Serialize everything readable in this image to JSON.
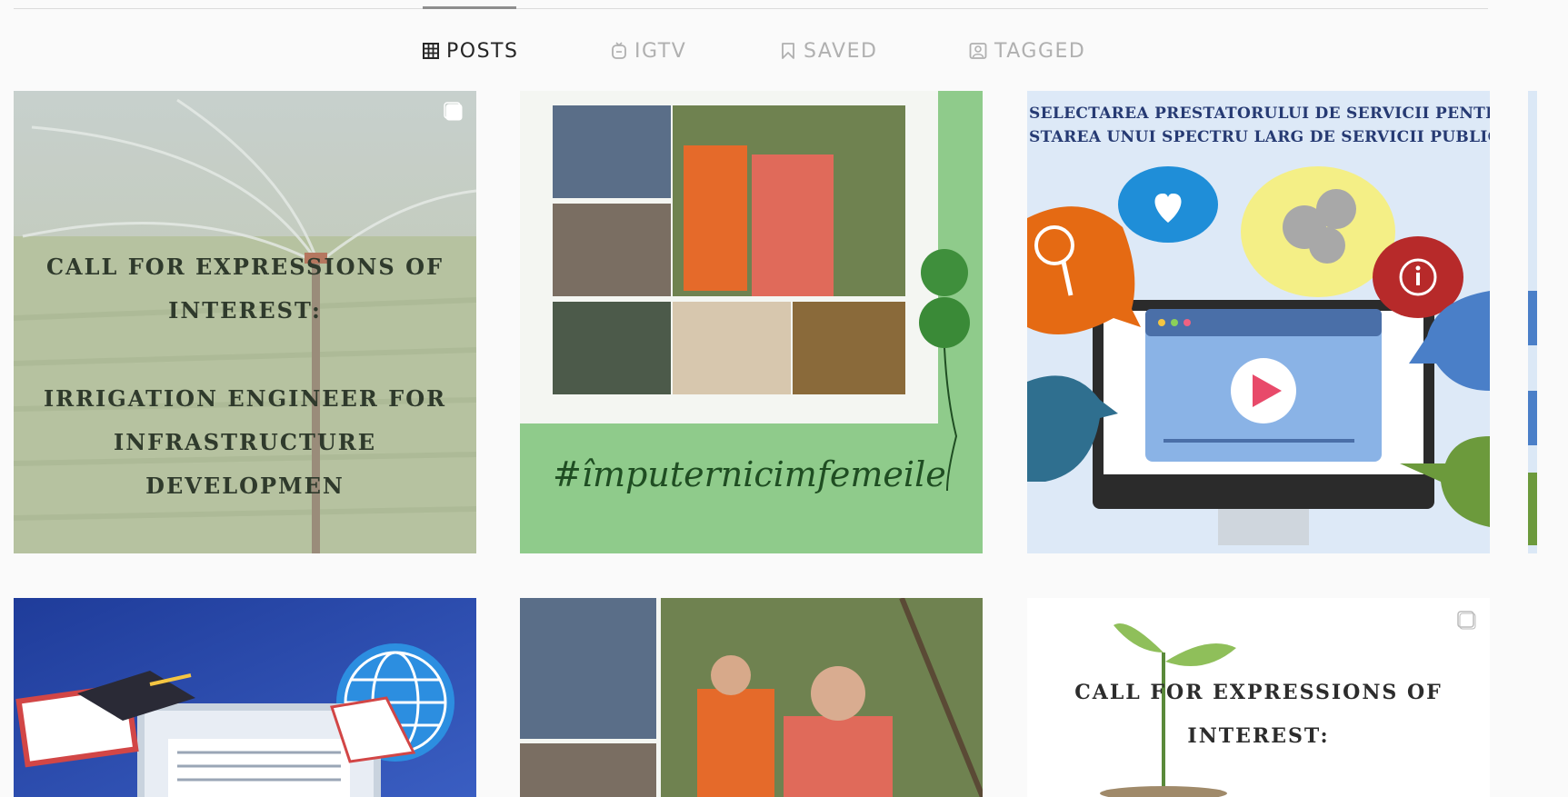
{
  "tabs": [
    {
      "label": "POSTS",
      "icon": "grid-icon",
      "active": true
    },
    {
      "label": "IGTV",
      "icon": "igtv-icon",
      "active": false
    },
    {
      "label": "SAVED",
      "icon": "bookmark-icon",
      "active": false
    },
    {
      "label": "TAGGED",
      "icon": "tagged-person-icon",
      "active": false
    }
  ],
  "posts": [
    {
      "kind": "text-over-photo",
      "line1": "CALL FOR EXPRESSIONS OF INTEREST:",
      "line2": "IRRIGATION ENGINEER FOR INFRASTRUCTURE DEVELOPMEN",
      "multi": true
    },
    {
      "kind": "collage",
      "hashtag": "#împuternicimfemeile"
    },
    {
      "kind": "banner",
      "line1": "SELECTAREA PRESTATORULUI DE SERVICII PENTRU",
      "line2": "STAREA UNUI SPECTRU LARG DE SERVICII PUBLICIT"
    },
    {
      "kind": "illustration"
    },
    {
      "kind": "photo"
    },
    {
      "kind": "text-over-photo",
      "line1": "CALL FOR EXPRESSIONS OF INTEREST:",
      "multi": true
    }
  ],
  "colors": {
    "active_tab": "#262626",
    "inactive_tab": "#b0b0b0",
    "background": "#fafafa"
  }
}
